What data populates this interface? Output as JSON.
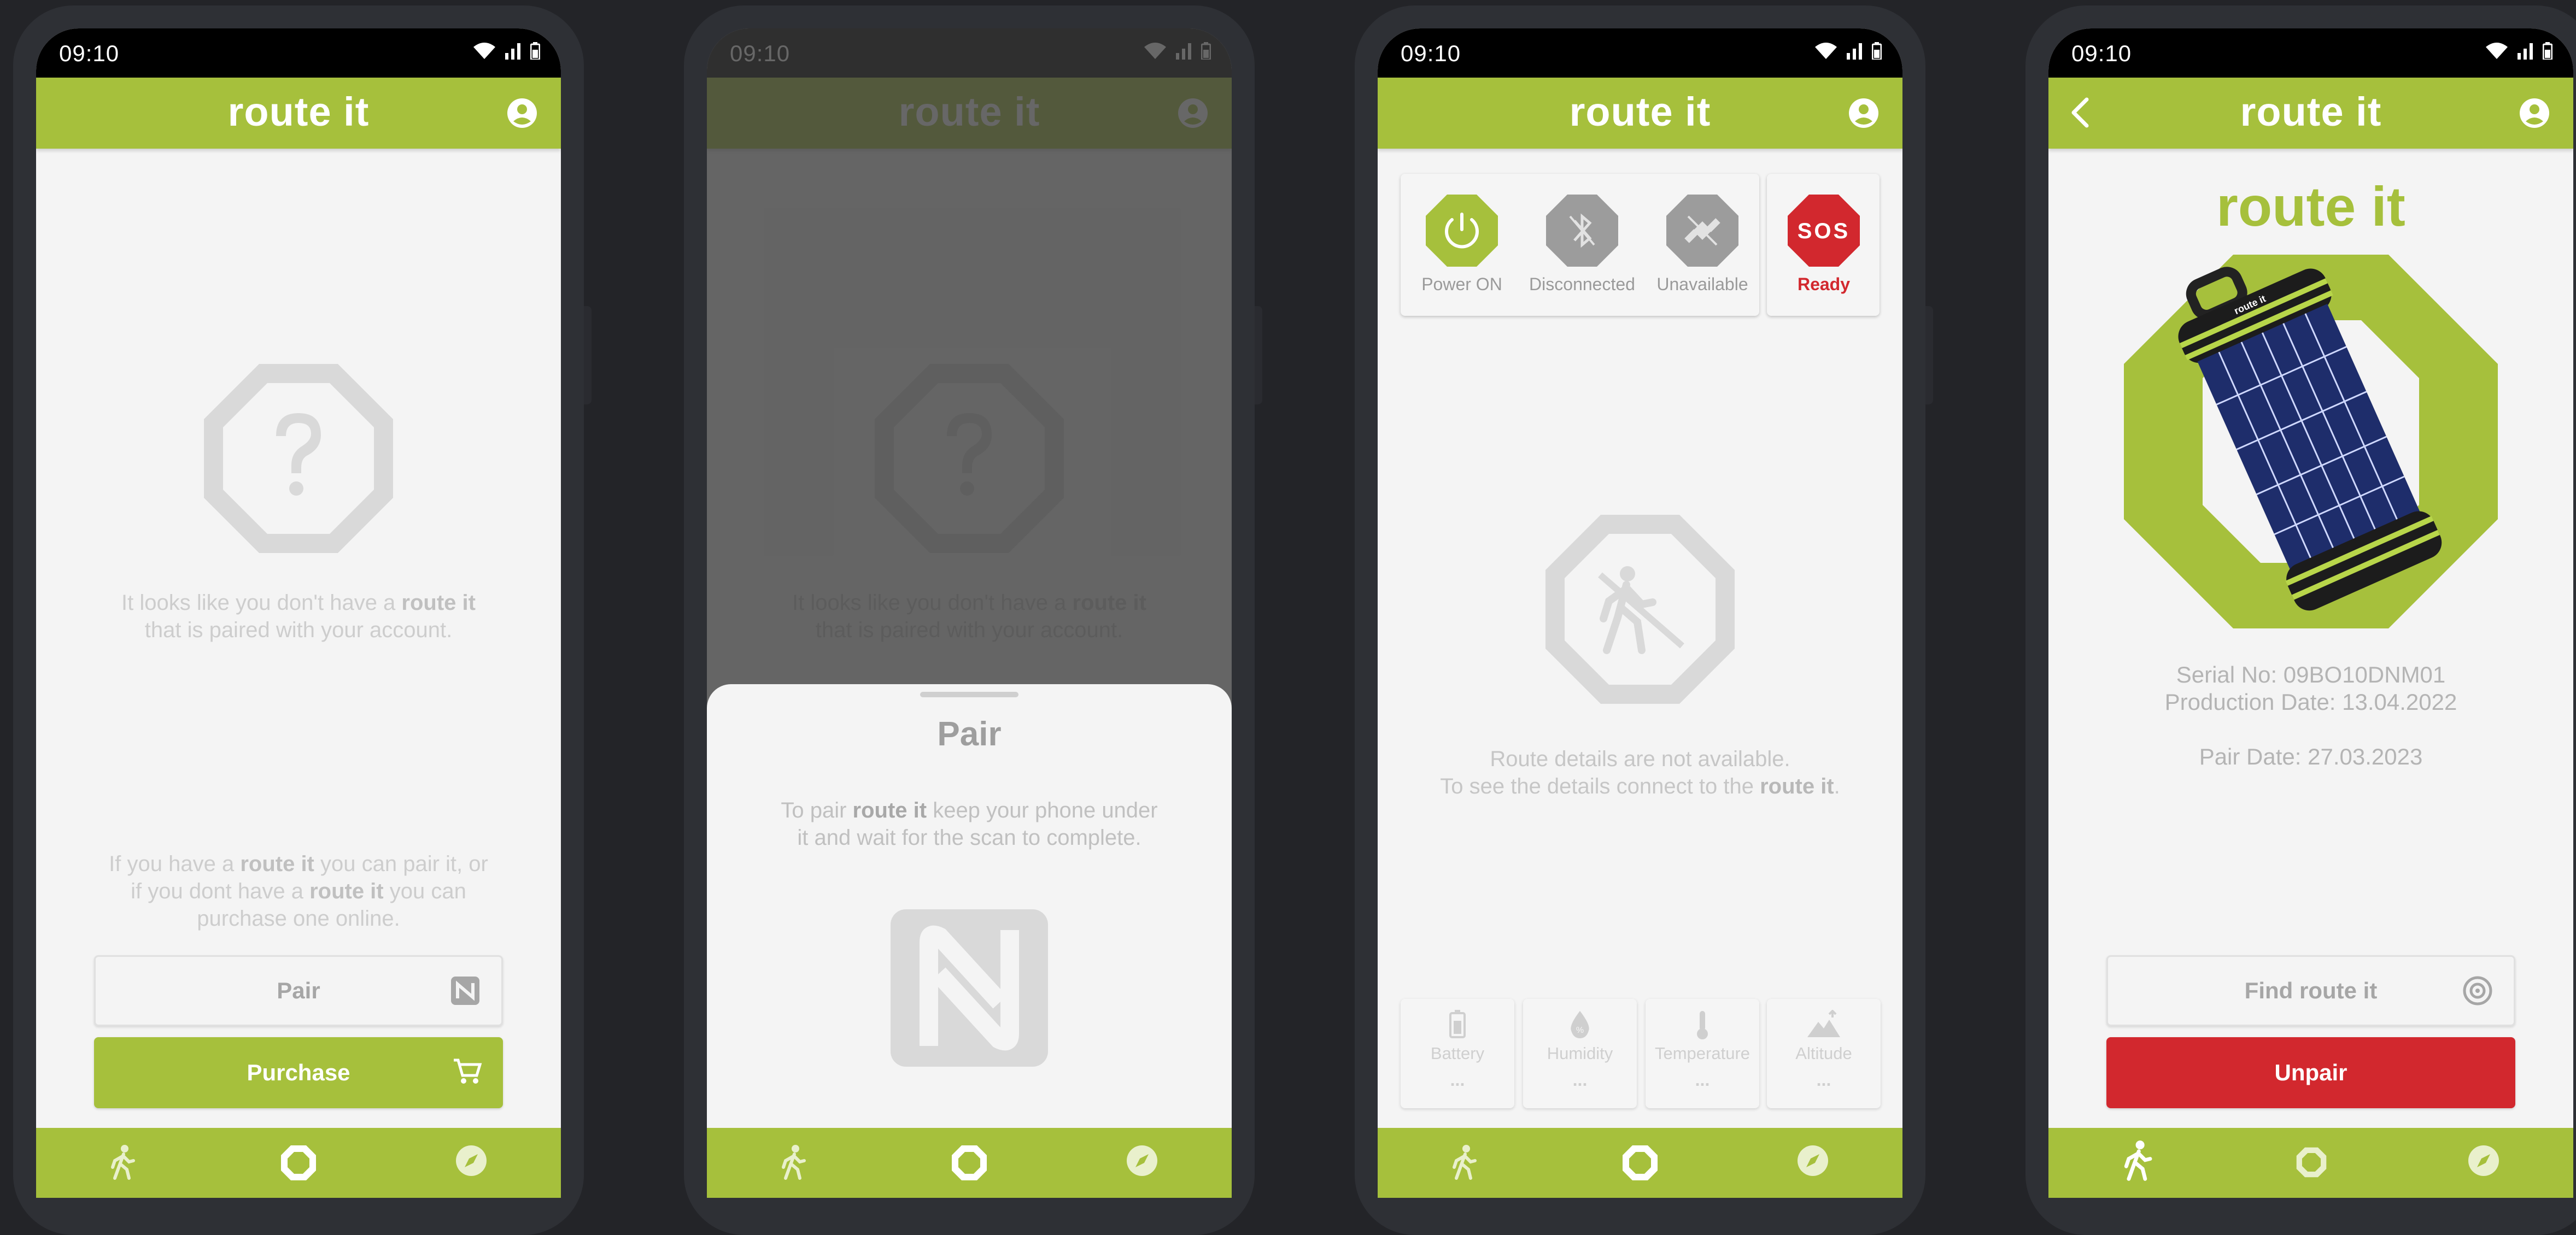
{
  "time": "09:10",
  "app_title": "route it",
  "brand_word": "route it",
  "colors": {
    "accent": "#a6c03c",
    "danger": "#d2282e",
    "muted": "#c6c6c6",
    "background": "#232428"
  },
  "screen1": {
    "msg_part1": "It looks like you don't have a ",
    "msg_part2": "that is paired with your account.",
    "hint_part1": "If you have a ",
    "hint_part2": " you can pair it, or",
    "hint_part3": "if you dont have a ",
    "hint_part4": " you can",
    "hint_part5": "purchase one online.",
    "pair_label": "Pair",
    "purchase_label": "Purchase"
  },
  "screen2": {
    "sheet_title": "Pair",
    "instr_part1": "To pair ",
    "instr_part2": " keep your phone under",
    "instr_part3": "it and wait for the scan to complete."
  },
  "screen3": {
    "status": [
      {
        "label": "Power ON",
        "icon": "power-icon"
      },
      {
        "label": "Disconnected",
        "icon": "bluetooth-off-icon"
      },
      {
        "label": "Unavailable",
        "icon": "satellite-off-icon"
      },
      {
        "label": "Ready",
        "icon": "sos-icon",
        "sign": "SOS"
      }
    ],
    "route_line1": "Route details are not available.",
    "route_line2_part1": "To see the details connect to the ",
    "route_line2_part2": ".",
    "sensors": [
      {
        "label": "Battery",
        "value": "...",
        "icon": "battery-icon"
      },
      {
        "label": "Humidity",
        "value": "...",
        "icon": "humidity-icon"
      },
      {
        "label": "Temperature",
        "value": "...",
        "icon": "thermometer-icon"
      },
      {
        "label": "Altitude",
        "value": "...",
        "icon": "mountain-icon"
      }
    ]
  },
  "screen4": {
    "device_title": "route it",
    "device_label": "route it",
    "serial": "Serial No: 09BO10DNM01",
    "production": "Production Date: 13.04.2022",
    "pair_date": "Pair Date: 27.03.2023",
    "find_label": "Find route it",
    "unpair_label": "Unpair"
  },
  "nav": [
    "walk-icon",
    "octagon-icon",
    "compass-icon"
  ]
}
